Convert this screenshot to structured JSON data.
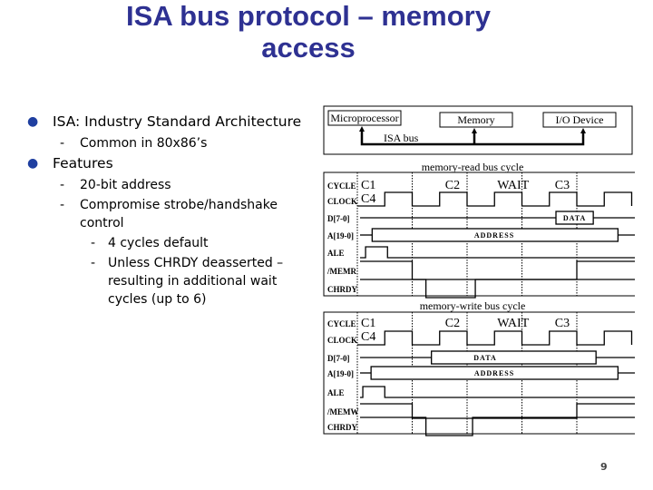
{
  "slide": {
    "title_lines": [
      "ISA bus protocol – memory",
      "access"
    ],
    "page_number": "9",
    "title_color": "#2e3192",
    "bullet_color": "#1f3fa0"
  },
  "bullets": [
    {
      "level": 1,
      "text": "ISA: Industry Standard Architecture"
    },
    {
      "level": 2,
      "text": "Common in 80x86’s"
    },
    {
      "level": 1,
      "text": "Features"
    },
    {
      "level": 2,
      "text": "20-bit address"
    },
    {
      "level": 2,
      "text": "Compromise strobe/handshake control"
    },
    {
      "level": 3,
      "text": "4 cycles default"
    },
    {
      "level": 3,
      "text": "Unless CHRDY deasserted – resulting in additional wait cycles (up to 6)"
    }
  ],
  "bus_diagram": {
    "devices": [
      "Microprocessor",
      "Memory",
      "I/O Device"
    ],
    "bus_label": "ISA bus"
  },
  "timing_diagrams": [
    {
      "title": "memory-read bus cycle",
      "cycle_labels": [
        "C1",
        "C2",
        "WAIT",
        "C3",
        "C4"
      ],
      "signals": [
        {
          "name": "CYCLE",
          "kind": "labels"
        },
        {
          "name": "CLOCK",
          "kind": "clock"
        },
        {
          "name": "D[7-0]",
          "kind": "bus",
          "label": "DATA",
          "valid": [
            3.62,
            4.3
          ]
        },
        {
          "name": "A[19-0]",
          "kind": "bus",
          "label": "ADDRESS",
          "valid": [
            0.27,
            4.75
          ]
        },
        {
          "name": "ALE",
          "kind": "digital",
          "start": 0,
          "edges": [
            0.15,
            0.55
          ]
        },
        {
          "name": "/MEMR",
          "kind": "digital",
          "start": 1,
          "edges": [
            1.0,
            4.0
          ]
        },
        {
          "name": "CHRDY",
          "kind": "digital",
          "start": 1,
          "edges": [
            1.25,
            2.15
          ]
        }
      ]
    },
    {
      "title": "memory-write bus cycle",
      "cycle_labels": [
        "C1",
        "C2",
        "WAIT",
        "C3",
        "C4"
      ],
      "signals": [
        {
          "name": "CYCLE",
          "kind": "labels"
        },
        {
          "name": "CLOCK",
          "kind": "clock"
        },
        {
          "name": "D[7-0]",
          "kind": "bus",
          "label": "DATA",
          "valid": [
            1.35,
            4.35
          ]
        },
        {
          "name": "A[19-0]",
          "kind": "bus",
          "label": "ADDRESS",
          "valid": [
            0.25,
            4.75
          ]
        },
        {
          "name": "ALE",
          "kind": "digital",
          "start": 0,
          "edges": [
            0.1,
            0.5
          ]
        },
        {
          "name": "/MEMW",
          "kind": "digital",
          "start": 1,
          "edges": [
            1.0,
            4.0
          ]
        },
        {
          "name": "CHRDY",
          "kind": "digital",
          "start": 1,
          "edges": [
            1.25,
            2.1
          ]
        }
      ]
    }
  ]
}
